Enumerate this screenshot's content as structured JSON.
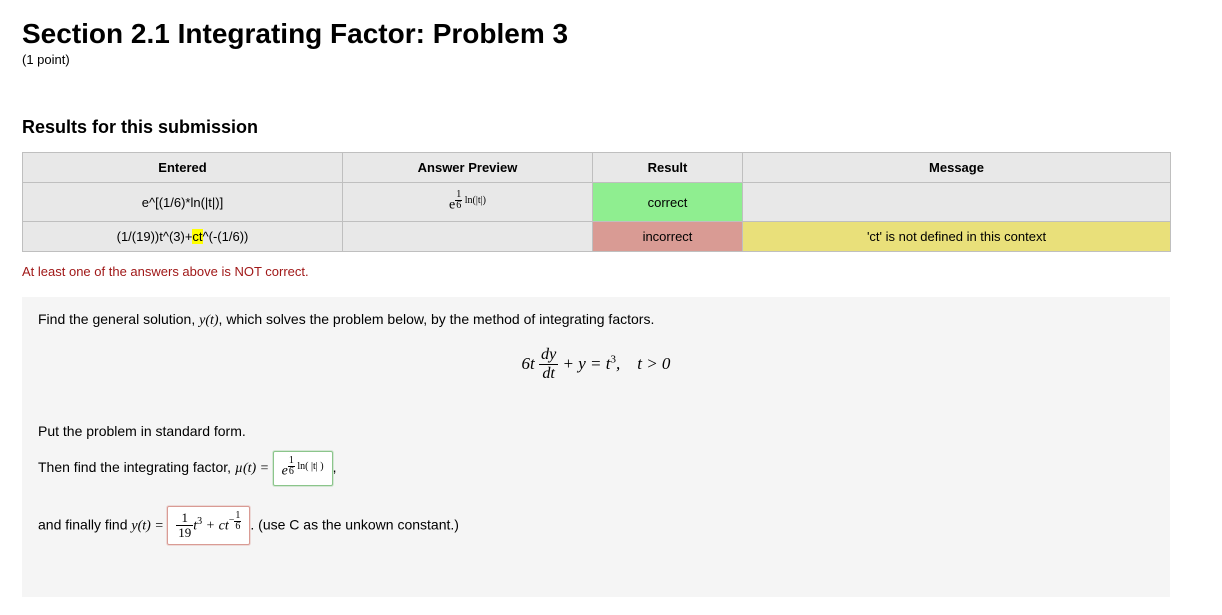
{
  "header": {
    "title": "Section 2.1 Integrating Factor: Problem 3",
    "points": "(1 point)"
  },
  "results": {
    "heading": "Results for this submission",
    "columns": [
      "Entered",
      "Answer Preview",
      "Result",
      "Message"
    ],
    "rows": [
      {
        "entered": "e^[(1/6)*ln(|t|)]",
        "preview_base": "e",
        "preview_exp_frac_num": "1",
        "preview_exp_frac_den": "6",
        "preview_exp_tail": " ln(|t|)",
        "result": "correct",
        "result_class": "correct",
        "message": "",
        "msg_class": "grey"
      },
      {
        "entered_pre": "(1/(19))t^(3)+",
        "entered_hl": "ct",
        "entered_post": "^(-(1/6))",
        "preview_base": "",
        "result": "incorrect",
        "result_class": "incorrect",
        "message": "'ct' is not defined in this context",
        "msg_class": "msg-warn"
      }
    ],
    "warning": "At least one of the answers above is NOT correct."
  },
  "problem": {
    "intro_pre": "Find the general solution, ",
    "intro_yoft": "y(t)",
    "intro_post": ", which solves the problem below, by the method of integrating factors.",
    "eqn": {
      "lead": "6t",
      "frac_num": "dy",
      "frac_den": "dt",
      "mid": " + y = t",
      "exp3": "3",
      "tail": ", t > 0"
    },
    "standard_form": "Put the problem in standard form.",
    "mu_line_pre": "Then find the integrating factor, ",
    "mu_symbol": "µ(t) = ",
    "mu_box": {
      "e": "e",
      "frac_num": "1",
      "frac_den": "6",
      "ln_body": " ln( |t| )"
    },
    "comma": ",",
    "y_line_pre": "and finally find ",
    "y_eq": "y(t) = ",
    "y_box": {
      "first_frac_num": "1",
      "first_frac_den": "19",
      "t": "t",
      "t_exp": "3",
      "plus": " + ct",
      "neg_exp_num": "1",
      "neg_exp_den": "6"
    },
    "y_tail": ". (use C as the unkown constant.)"
  }
}
